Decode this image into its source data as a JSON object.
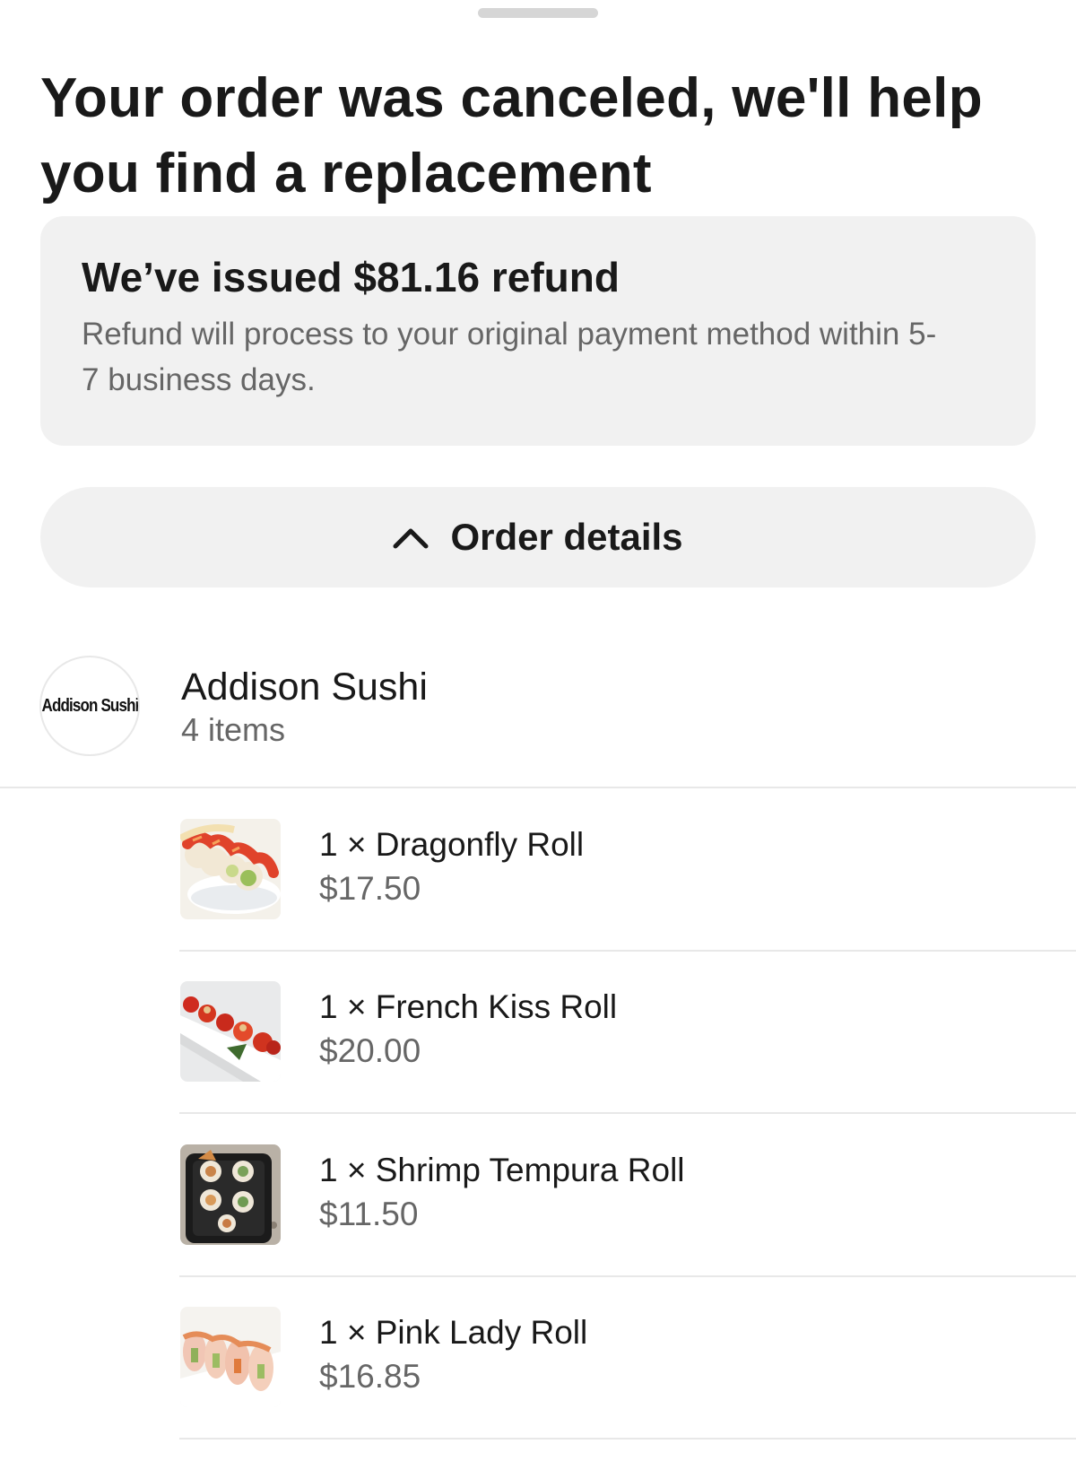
{
  "header": {
    "title": "Your order was canceled, we'll help you find a replacement"
  },
  "refund": {
    "title": "We’ve issued $81.16 refund",
    "body": "Refund will process to your original payment method within 5-7 business days."
  },
  "order_details": {
    "label": "Order details",
    "icon": "chevron-up-icon",
    "expanded": true
  },
  "store": {
    "logo_text": "Addison Sushi",
    "name": "Addison Sushi",
    "item_count": "4 items"
  },
  "items": [
    {
      "qty_name": "1 × Dragonfly Roll",
      "price": "$17.50"
    },
    {
      "qty_name": "1 × French Kiss Roll",
      "price": "$20.00"
    },
    {
      "qty_name": "1 × Shrimp Tempura Roll",
      "price": "$11.50"
    },
    {
      "qty_name": "1 × Pink Lady Roll",
      "price": "$16.85"
    }
  ],
  "colors": {
    "primary_text": "#191919",
    "secondary_text": "#666666",
    "card_background": "#f1f1f1",
    "divider": "#e8e8e8"
  }
}
